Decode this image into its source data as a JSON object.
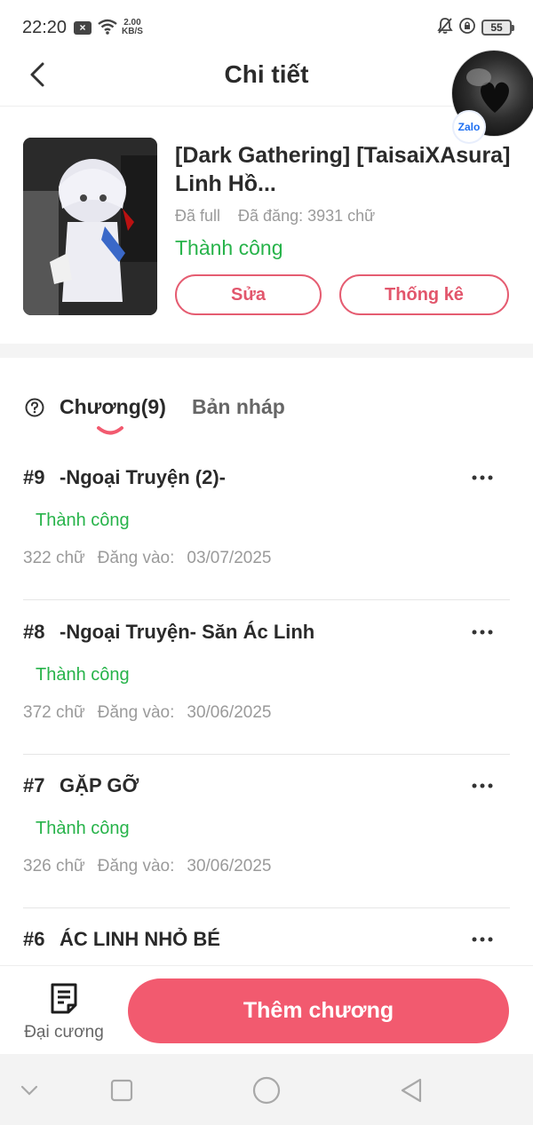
{
  "status_bar": {
    "time": "22:20",
    "notification_icon": "x-icon",
    "net_speed_value": "2.00",
    "net_speed_unit": "KB/S",
    "battery": "55"
  },
  "header": {
    "title": "Chi tiết",
    "zalo_label": "Zalo"
  },
  "book": {
    "title": "[Dark Gathering] [TaisaiXAsura] Linh Hồ...",
    "completion": "Đã full",
    "posted_words": "Đã đăng: 3931 chữ",
    "status": "Thành công",
    "edit_label": "Sửa",
    "stats_label": "Thống kê"
  },
  "tabs": {
    "chapters_label": "Chương(9)",
    "drafts_label": "Bản nháp"
  },
  "chapters": [
    {
      "number": "#9",
      "title": "-Ngoại Truyện (2)-",
      "status": "Thành công",
      "words": "322 chữ",
      "posted_label": "Đăng vào:",
      "date": "03/07/2025"
    },
    {
      "number": "#8",
      "title": "-Ngoại Truyện- Săn Ác Linh",
      "status": "Thành công",
      "words": "372 chữ",
      "posted_label": "Đăng vào:",
      "date": "30/06/2025"
    },
    {
      "number": "#7",
      "title": "GẶP GỠ",
      "status": "Thành công",
      "words": "326 chữ",
      "posted_label": "Đăng vào:",
      "date": "30/06/2025"
    },
    {
      "number": "#6",
      "title": "ÁC LINH NHỎ BÉ"
    }
  ],
  "bottom_bar": {
    "outline_label": "Đại cương",
    "add_chapter_label": "Thêm chương"
  },
  "colors": {
    "accent": "#f25a6f",
    "success": "#27b34a",
    "muted": "#9a9a9a"
  }
}
